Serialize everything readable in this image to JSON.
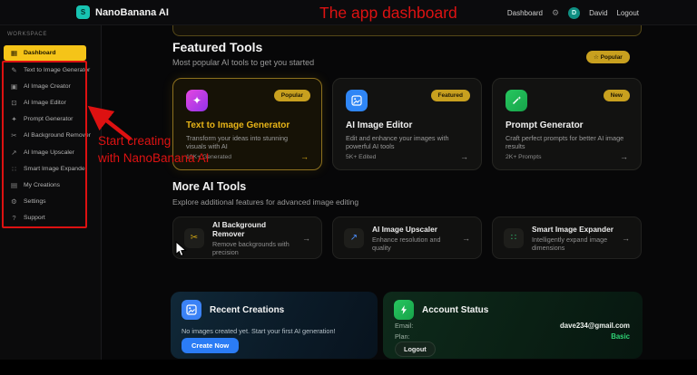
{
  "icons": {
    "dashboard": "▦",
    "pencil": "✎",
    "image_frame": "▣",
    "edit": "⊡",
    "sparkle": "✦",
    "scissors": "✂",
    "upscale": "↗",
    "expander": "∷",
    "folder": "▤",
    "gear": "⚙",
    "question": "?",
    "star": "☆",
    "arrow_right": "→"
  },
  "header": {
    "logo_letter": "S",
    "app_title": "NanoBanana AI",
    "nav_dashboard": "Dashboard",
    "avatar_letter": "D",
    "user_name": "David",
    "logout_label": "Logout"
  },
  "annotations": {
    "top_note": "The app dashboard",
    "note_line1": "Start creating",
    "note_line2": "with NanoBanana AI",
    "accent_color": "#dd1111"
  },
  "sidebar": {
    "section_label": "WORKSPACE",
    "items": [
      {
        "label": "Dashboard",
        "active": true
      },
      {
        "label": "Text to Image Generator"
      },
      {
        "label": "AI Image Creator"
      },
      {
        "label": "AI Image Editor"
      },
      {
        "label": "Prompt Generator"
      },
      {
        "label": "AI Background Remover"
      },
      {
        "label": "AI Image Upscaler"
      },
      {
        "label": "Smart Image Expander"
      },
      {
        "label": "My Creations"
      },
      {
        "label": "Settings"
      },
      {
        "label": "Support"
      }
    ]
  },
  "featured": {
    "title": "Featured Tools",
    "subtitle": "Most popular AI tools to get you started",
    "section_badge": "Popular",
    "cards": [
      {
        "title": "Text to Image Generator",
        "badge": "Popular",
        "description": "Transform your ideas into stunning visuals with AI",
        "stat": "10K+ Generated",
        "accent": "#d946ef"
      },
      {
        "title": "AI Image Editor",
        "badge": "Featured",
        "description": "Edit and enhance your images with powerful AI tools",
        "stat": "5K+ Edited",
        "accent": "#3b82f6"
      },
      {
        "title": "Prompt Generator",
        "badge": "New",
        "description": "Craft perfect prompts for better AI image results",
        "stat": "2K+ Prompts",
        "accent": "#22c55e"
      }
    ]
  },
  "more_tools": {
    "title": "More AI Tools",
    "subtitle": "Explore additional features for advanced image editing",
    "cards": [
      {
        "title": "AI Background Remover",
        "description": "Remove backgrounds with precision",
        "accent": "#d4a713"
      },
      {
        "title": "AI Image Upscaler",
        "description": "Enhance resolution and quality",
        "accent": "#4b8bf5"
      },
      {
        "title": "Smart Image Expander",
        "description": "Intelligently expand image dimensions",
        "accent": "#2fbf71"
      }
    ]
  },
  "recent_creations": {
    "title": "Recent Creations",
    "empty_text": "No images created yet. Start your first AI generation!",
    "cta_label": "Create Now"
  },
  "account_status": {
    "title": "Account Status",
    "email_label": "Email:",
    "email_value": "dave234@gmail.com",
    "plan_label": "Plan:",
    "plan_value": "Basic",
    "logout_label": "Logout"
  }
}
